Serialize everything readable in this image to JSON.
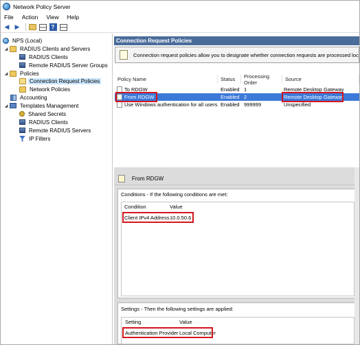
{
  "window": {
    "title": "Network Policy Server"
  },
  "menu": [
    "File",
    "Action",
    "View",
    "Help"
  ],
  "toolbar": {
    "back_icon": "back-arrow-icon",
    "forward_icon": "forward-arrow-icon",
    "help_glyph": "?"
  },
  "tree": {
    "root": "NPS (Local)",
    "radius_clients_servers": "RADIUS Clients and Servers",
    "radius_clients": "RADIUS Clients",
    "remote_radius_groups": "Remote RADIUS Server Groups",
    "policies": "Policies",
    "connection_request_policies": "Connection Request Policies",
    "network_policies": "Network Policies",
    "accounting": "Accounting",
    "templates_management": "Templates Management",
    "shared_secrets": "Shared Secrets",
    "tm_radius_clients": "RADIUS Clients",
    "remote_radius_servers": "Remote RADIUS Servers",
    "ip_filters": "IP Filters"
  },
  "main": {
    "header": "Connection Request Policies",
    "info": "Connection request policies allow you to designate whether connection requests are processed locally or forwarded to remote RADIUS servers."
  },
  "policy_table": {
    "columns": [
      "Policy Name",
      "Status",
      "Processing Order",
      "Source"
    ],
    "rows": [
      {
        "name": "To RDGW",
        "status": "Enabled",
        "order": "1",
        "source": "Remote Desktop Gateway"
      },
      {
        "name": "From RDGW",
        "status": "Enabled",
        "order": "2",
        "source": "Remote Desktop Gateway"
      },
      {
        "name": "Use Windows authentication for all users",
        "status": "Enabled",
        "order": "999999",
        "source": "Unspecified"
      }
    ],
    "selected_index": 1
  },
  "detail": {
    "title": "From RDGW",
    "conditions_label": "Conditions - If the following conditions are met:",
    "conditions_columns": [
      "Condition",
      "Value"
    ],
    "conditions": [
      {
        "condition": "Client IPv4 Address",
        "value": "10.0.50.6"
      }
    ],
    "settings_label": "Settings - Then the following settings are applied:",
    "settings_columns": [
      "Setting",
      "Value"
    ],
    "settings": [
      {
        "setting": "Authentication Provider",
        "value": "Local Computer"
      }
    ]
  },
  "colors": {
    "header_bg": "#4a6c9a",
    "selected_row": "#3c79d8",
    "highlight_box": "#d4141c",
    "tree_selected": "#cce8ff"
  }
}
